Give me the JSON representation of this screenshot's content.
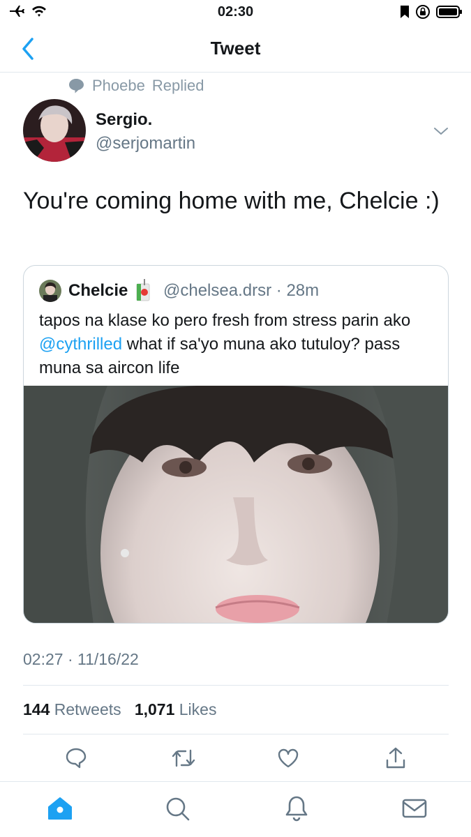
{
  "status_bar": {
    "time": "02:30"
  },
  "nav": {
    "title": "Tweet"
  },
  "context": {
    "user": "Phoebe",
    "action": "Replied"
  },
  "tweet": {
    "author_name": "Sergio.",
    "author_handle": "@serjomartin",
    "text": "You're coming home with me, Chelcie :)",
    "timestamp": "02:27 · 11/16/22",
    "retweet_count": "144",
    "retweet_label": "Retweets",
    "like_count": "1,071",
    "like_label": "Likes"
  },
  "quoted": {
    "author_name": "Chelcie",
    "author_handle": "@chelsea.drsr",
    "separator": "·",
    "age": "28m",
    "text_before": "tapos na klase ko pero fresh from stress parin ako ",
    "mention": "@cythrilled",
    "text_after": " what if sa'yo muna ako tutuloy? pass muna sa aircon life"
  },
  "icons": {
    "reply": "reply-icon",
    "retweet": "retweet-icon",
    "like": "heart-icon",
    "share": "share-icon",
    "home": "home-icon",
    "search": "search-icon",
    "notifications": "bell-icon",
    "messages": "mail-icon"
  },
  "colors": {
    "accent": "#1da1f2",
    "muted": "#657786"
  }
}
